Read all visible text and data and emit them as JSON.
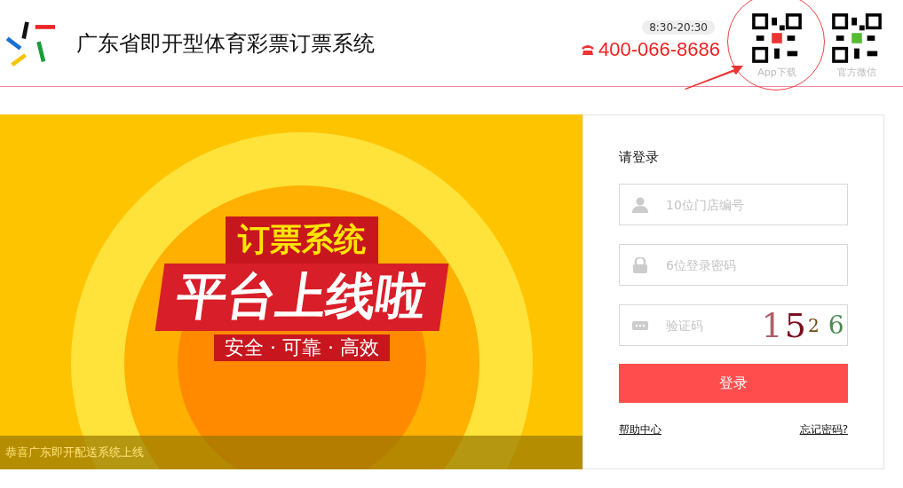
{
  "header": {
    "title": "广东省即开型体育彩票订票系统",
    "hours": "8:30-20:30",
    "phone": "400-066-8686",
    "qr_codes": [
      {
        "caption": "App下载",
        "highlighted": true
      },
      {
        "caption": "官方微信",
        "highlighted": false
      }
    ]
  },
  "banner": {
    "headline": "订票系统",
    "slogan": "平台上线啦",
    "tagline": "安全 · 可靠 · 高效",
    "caption": "恭喜广东即开配送系统上线"
  },
  "login": {
    "title": "请登录",
    "fields": [
      {
        "kind": "user",
        "placeholder": "10位门店编号"
      },
      {
        "kind": "lock",
        "placeholder": "6位登录密码"
      },
      {
        "kind": "code",
        "placeholder": "验证码",
        "captcha": [
          "1",
          "5",
          "2",
          "6"
        ]
      }
    ],
    "submit": "登录",
    "links": [
      "帮助中心",
      "忘记密码?"
    ]
  }
}
